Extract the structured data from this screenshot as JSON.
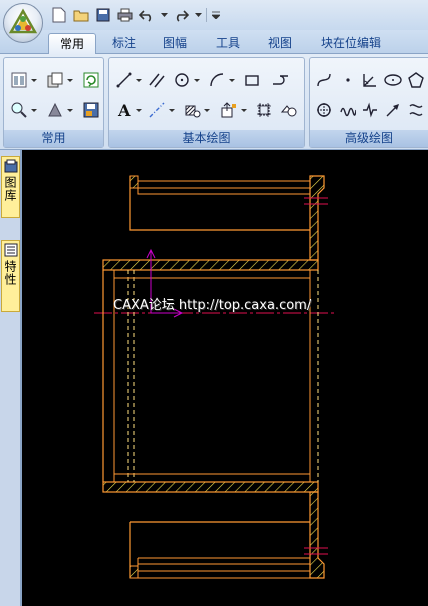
{
  "tabs": [
    {
      "label": "常用",
      "active": true
    },
    {
      "label": "标注",
      "active": false
    },
    {
      "label": "图幅",
      "active": false
    },
    {
      "label": "工具",
      "active": false
    },
    {
      "label": "视图",
      "active": false
    },
    {
      "label": "块在位编辑",
      "active": false
    }
  ],
  "ribbon": {
    "groups": [
      {
        "label": "常用"
      },
      {
        "label": "基本绘图"
      },
      {
        "label": "高级绘图"
      }
    ]
  },
  "dock": {
    "tabs": [
      {
        "label": "图库",
        "icon": "library-icon"
      },
      {
        "label": "特性",
        "icon": "properties-icon"
      }
    ]
  },
  "canvas": {
    "watermark": "CAXA论坛 http://top.caxa.com/"
  },
  "colors": {
    "outline": "#ff9933",
    "hatch": "#f0e050",
    "centerline": "#e01050",
    "hidden": "#ffe080",
    "cursor": "#cc00cc"
  }
}
